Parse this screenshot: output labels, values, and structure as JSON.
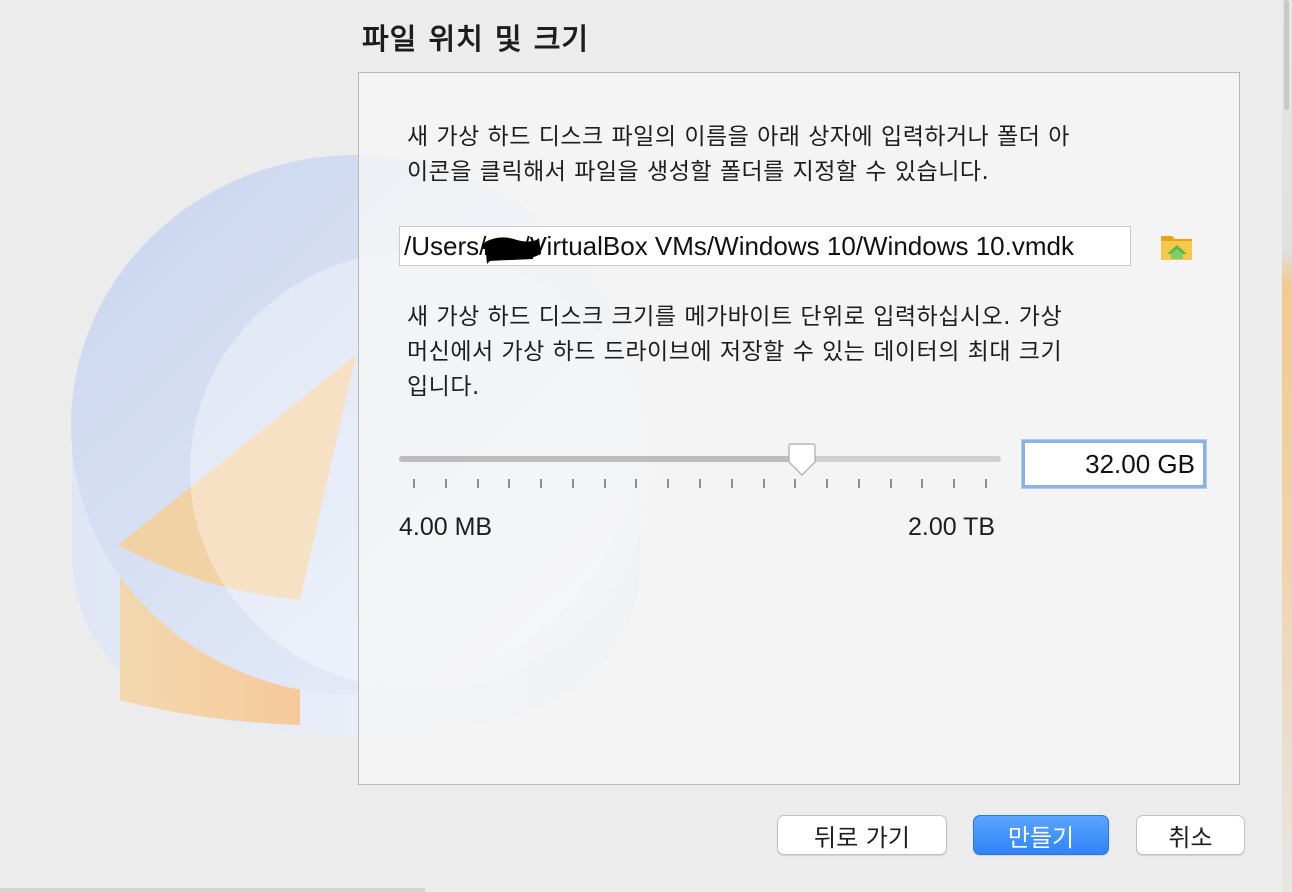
{
  "page": {
    "title": "파일 위치 및 크기"
  },
  "location": {
    "description": "새 가상 하드 디스크 파일의 이름을 아래 상자에 입력하거나 폴더 아\n이콘을 클릭해서 파일을 생성할 폴더를 지정할 수 있습니다.",
    "path_value": "/Users/     /VirtualBox VMs/Windows 10/Windows 10.vmdk",
    "folder_icon": "folder-icon"
  },
  "size": {
    "description": "새 가상 하드 디스크 크기를 메가바이트 단위로 입력하십시오. 가상\n머신에서 가상 하드 드라이브에 저장할 수 있는 데이터의 최대 크기\n입니다.",
    "value": "32.00 GB",
    "min_label": "4.00 MB",
    "max_label": "2.00 TB",
    "slider_fraction": 0.67,
    "tick_count": 19
  },
  "buttons": {
    "back": "뒤로 가기",
    "create": "만들기",
    "cancel": "취소"
  },
  "colors": {
    "accent": "#2f84f6",
    "focus_ring": "#8fb0e3"
  }
}
